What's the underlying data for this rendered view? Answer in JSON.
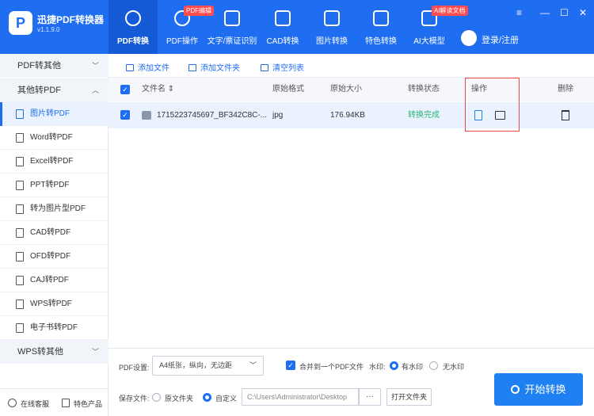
{
  "app": {
    "name": "迅捷PDF转换器",
    "version": "v1.1.9.0",
    "logo_letter": "P"
  },
  "nav": [
    {
      "label": "PDF转换",
      "badge": "",
      "icon": "pdf-convert-icon"
    },
    {
      "label": "PDF操作",
      "badge": "PDF编辑",
      "icon": "pdf-operate-icon"
    },
    {
      "label": "文字/票证识别",
      "badge": "",
      "icon": "ocr-icon"
    },
    {
      "label": "CAD转换",
      "badge": "",
      "icon": "cad-icon"
    },
    {
      "label": "图片转换",
      "badge": "",
      "icon": "image-icon"
    },
    {
      "label": "特色转换",
      "badge": "",
      "icon": "star-icon"
    },
    {
      "label": "AI大模型",
      "badge": "AI解读文档",
      "icon": "ai-icon"
    }
  ],
  "user": {
    "label": "登录/注册"
  },
  "window": {
    "menu": "≡",
    "min": "—",
    "max": "☐",
    "close": "✕"
  },
  "sidebar": {
    "section1": "PDF转其他",
    "section2": "其他转PDF",
    "section3": "WPS转其他",
    "items": [
      "图片转PDF",
      "Word转PDF",
      "Excel转PDF",
      "PPT转PDF",
      "转为图片型PDF",
      "CAD转PDF",
      "OFD转PDF",
      "CAJ转PDF",
      "WPS转PDF",
      "电子书转PDF"
    ],
    "support": "在线客服",
    "featured": "特色产品"
  },
  "toolbar": {
    "add_file": "添加文件",
    "add_folder": "添加文件夹",
    "clear": "清空列表"
  },
  "table": {
    "headers": {
      "name": "文件名 ⇕",
      "format": "原始格式",
      "size": "原始大小",
      "status": "转换状态",
      "action": "操作",
      "delete": "删除"
    },
    "rows": [
      {
        "name": "1715223745697_BF342C8C-...",
        "format": "jpg",
        "size": "176.94KB",
        "status": "转换完成"
      }
    ]
  },
  "settings": {
    "pdf_label": "PDF设置:",
    "pdf_value": "A4纸张，纵向，无边距",
    "merge": "合并到一个PDF文件",
    "watermark_label": "水印:",
    "watermark_on": "有水印",
    "watermark_off": "无水印",
    "save_label": "保存文件:",
    "save_original": "原文件夹",
    "save_custom": "自定义",
    "path": "C:\\Users\\Administrator\\Desktop",
    "dots": "···",
    "open_folder": "打开文件夹",
    "start": "开始转换"
  },
  "colors": {
    "brand": "#1f6ef2",
    "success": "#2bb673",
    "highlight": "#e94b43"
  }
}
